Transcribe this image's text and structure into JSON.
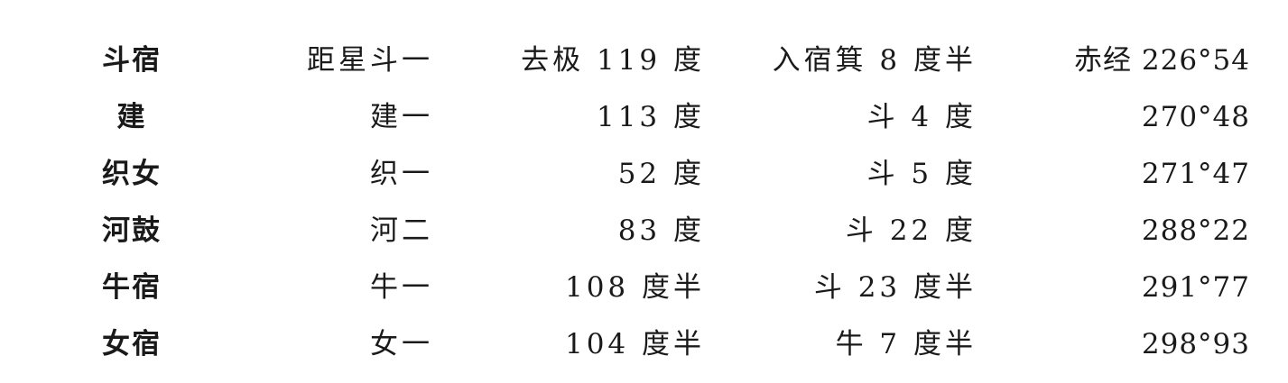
{
  "rows": [
    {
      "name": "斗宿",
      "star": "距星斗一",
      "polar": "去极 119 度",
      "entry": "入宿箕 8 度半",
      "ra": "赤经 226°54"
    },
    {
      "name": "建",
      "star": "建一",
      "polar": "113 度",
      "entry": "斗 4 度",
      "ra": "270°48"
    },
    {
      "name": "织女",
      "star": "织一",
      "polar": "52 度",
      "entry": "斗 5 度",
      "ra": "271°47"
    },
    {
      "name": "河鼓",
      "star": "河二",
      "polar": "83 度",
      "entry": "斗 22 度",
      "ra": "288°22"
    },
    {
      "name": "牛宿",
      "star": "牛一",
      "polar": "108 度半",
      "entry": "斗 23 度半",
      "ra": "291°77"
    },
    {
      "name": "女宿",
      "star": "女一",
      "polar": "104 度半",
      "entry": "牛 7 度半",
      "ra": "298°93"
    }
  ]
}
